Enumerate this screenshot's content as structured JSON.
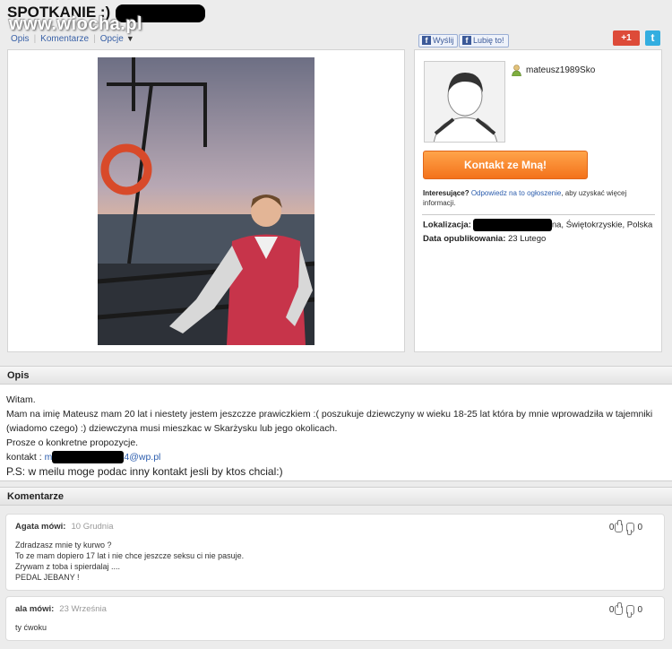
{
  "header": {
    "title": "SPOTKANIE :)",
    "watermark": "www.wiocha.pl",
    "tabs": [
      {
        "label": "Opis"
      },
      {
        "label": "Komentarze"
      },
      {
        "label": "Opcje"
      }
    ],
    "fb_send": "Wyślij",
    "fb_like": "Lubię to!",
    "gplus": "+1"
  },
  "profile": {
    "username": "mateusz1989Sko",
    "contact_button": "Kontakt ze Mną!",
    "interest_label": "Interesujące?",
    "interest_link": "Odpowiedz na to ogłoszenie",
    "interest_rest": ", aby uzyskać więcej informacji.",
    "location_label": "Lokalizacja:",
    "location_value": "na, Świętokrzyskie, Polska",
    "published_label": "Data opublikowania:",
    "published_value": "23 Lutego"
  },
  "description": {
    "heading": "Opis",
    "line1": "Witam.",
    "line2": "Mam na imię Mateusz mam 20 lat i niestety jestem jeszczze prawiczkiem :( poszukuje dziewczyny w wieku 18-25 lat która by mnie wprowadziła w tajemniki (wiadomo czego) :) dziewczyna musi mieszkac w Skarżysku lub jego okolicach.",
    "line3": "Prosze o konkretne propozycje.",
    "contact_label": "kontakt :",
    "email_start": "m",
    "email_end": "4@wp.pl",
    "ps": "P.S: w meilu moge podac inny kontakt jesli by ktos chcial:)"
  },
  "comments": {
    "heading": "Komentarze",
    "items": [
      {
        "author": "Agata mówi:",
        "date": "10 Grudnia",
        "lines": [
          "Zdradzasz mnie ty kurwo ?",
          "To ze mam dopiero 17 lat i nie chce jeszcze seksu ci nie pasuje.",
          "Zrywam z toba i spierdalaj ....",
          "PEDAL JEBANY !"
        ],
        "up": "0",
        "down": "0"
      },
      {
        "author": "ala mówi:",
        "date": "23 Września",
        "lines": [
          "ty ćwoku"
        ],
        "up": "0",
        "down": "0"
      }
    ]
  }
}
